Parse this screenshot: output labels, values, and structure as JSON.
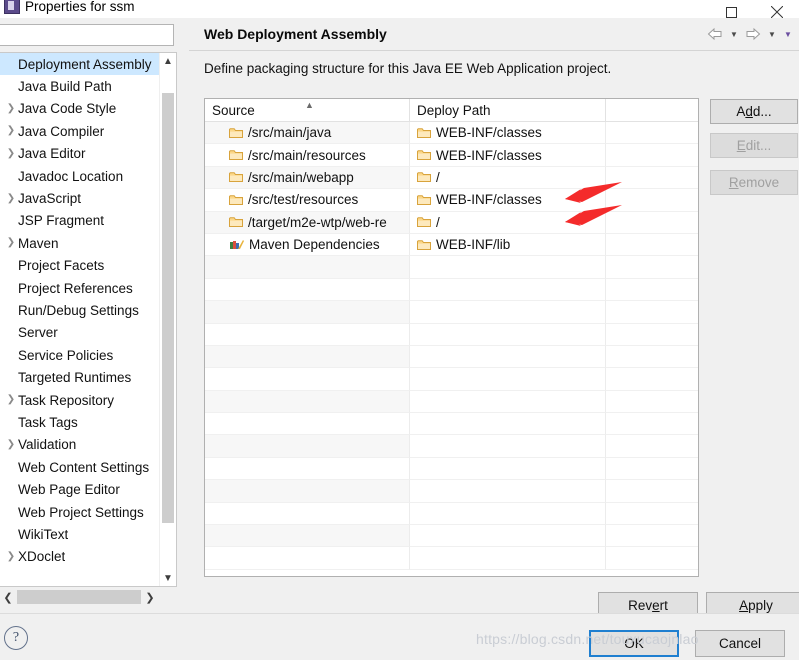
{
  "window": {
    "title": "Properties for ssm",
    "icon": "eclipse-properties-icon",
    "maximize_label": "maximize-icon",
    "close_label": "close-icon"
  },
  "sidebar": {
    "filter": {
      "value": "",
      "placeholder": ""
    },
    "items": [
      {
        "label": "Deployment Assembly",
        "expandable": false,
        "selected": true
      },
      {
        "label": "Java Build Path",
        "expandable": false,
        "selected": false
      },
      {
        "label": "Java Code Style",
        "expandable": true,
        "selected": false
      },
      {
        "label": "Java Compiler",
        "expandable": true,
        "selected": false
      },
      {
        "label": "Java Editor",
        "expandable": true,
        "selected": false
      },
      {
        "label": "Javadoc Location",
        "expandable": false,
        "selected": false
      },
      {
        "label": "JavaScript",
        "expandable": true,
        "selected": false
      },
      {
        "label": "JSP Fragment",
        "expandable": false,
        "selected": false
      },
      {
        "label": "Maven",
        "expandable": true,
        "selected": false
      },
      {
        "label": "Project Facets",
        "expandable": false,
        "selected": false
      },
      {
        "label": "Project References",
        "expandable": false,
        "selected": false
      },
      {
        "label": "Run/Debug Settings",
        "expandable": false,
        "selected": false
      },
      {
        "label": "Server",
        "expandable": false,
        "selected": false
      },
      {
        "label": "Service Policies",
        "expandable": false,
        "selected": false
      },
      {
        "label": "Targeted Runtimes",
        "expandable": false,
        "selected": false
      },
      {
        "label": "Task Repository",
        "expandable": true,
        "selected": false
      },
      {
        "label": "Task Tags",
        "expandable": false,
        "selected": false
      },
      {
        "label": "Validation",
        "expandable": true,
        "selected": false
      },
      {
        "label": "Web Content Settings",
        "expandable": false,
        "selected": false
      },
      {
        "label": "Web Page Editor",
        "expandable": false,
        "selected": false
      },
      {
        "label": "Web Project Settings",
        "expandable": false,
        "selected": false
      },
      {
        "label": "WikiText",
        "expandable": false,
        "selected": false
      },
      {
        "label": "XDoclet",
        "expandable": true,
        "selected": false
      }
    ]
  },
  "panel": {
    "title": "Web Deployment Assembly",
    "description": "Define packaging structure for this Java EE Web Application project.",
    "nav": {
      "back": "back-arrow-icon",
      "back_menu": "chevron-down-icon",
      "forward": "forward-arrow-icon",
      "forward_menu": "chevron-down-icon",
      "overflow_menu": "chevron-down-icon"
    }
  },
  "table": {
    "columns": [
      "Source",
      "Deploy Path",
      ""
    ],
    "sort_column": "Source",
    "sort_direction": "ascending",
    "rows": [
      {
        "source": "/src/main/java",
        "source_icon": "folder-icon",
        "deploy": "WEB-INF/classes",
        "deploy_icon": "folder-icon"
      },
      {
        "source": "/src/main/resources",
        "source_icon": "folder-icon",
        "deploy": "WEB-INF/classes",
        "deploy_icon": "folder-icon"
      },
      {
        "source": "/src/main/webapp",
        "source_icon": "folder-icon",
        "deploy": "/",
        "deploy_icon": "folder-icon"
      },
      {
        "source": "/src/test/resources",
        "source_icon": "folder-icon",
        "deploy": "WEB-INF/classes",
        "deploy_icon": "folder-icon"
      },
      {
        "source": "/target/m2e-wtp/web-re",
        "source_icon": "folder-icon",
        "deploy": "/",
        "deploy_icon": "folder-icon"
      },
      {
        "source": "Maven Dependencies",
        "source_icon": "library-icon",
        "deploy": "WEB-INF/lib",
        "deploy_icon": "folder-icon"
      }
    ],
    "empty_row_count": 14
  },
  "side_buttons": [
    {
      "label": "Add...",
      "mnemonic": "d",
      "enabled": true
    },
    {
      "label": "Edit...",
      "mnemonic": "E",
      "enabled": false
    },
    {
      "label": "Remove",
      "mnemonic": "R",
      "enabled": false
    }
  ],
  "page_buttons": {
    "revert": "Revert",
    "apply": "Apply"
  },
  "footer": {
    "help": "?",
    "ok": "OK",
    "cancel": "Cancel"
  },
  "annotations": {
    "arrow_color": "#f42b2b",
    "arrow_count": 2,
    "targets": [
      "/src/test/resources row",
      "/target/m2e-wtp/web-re row"
    ]
  },
  "watermark": "https://blog.csdn.net/touxucaojnlao"
}
